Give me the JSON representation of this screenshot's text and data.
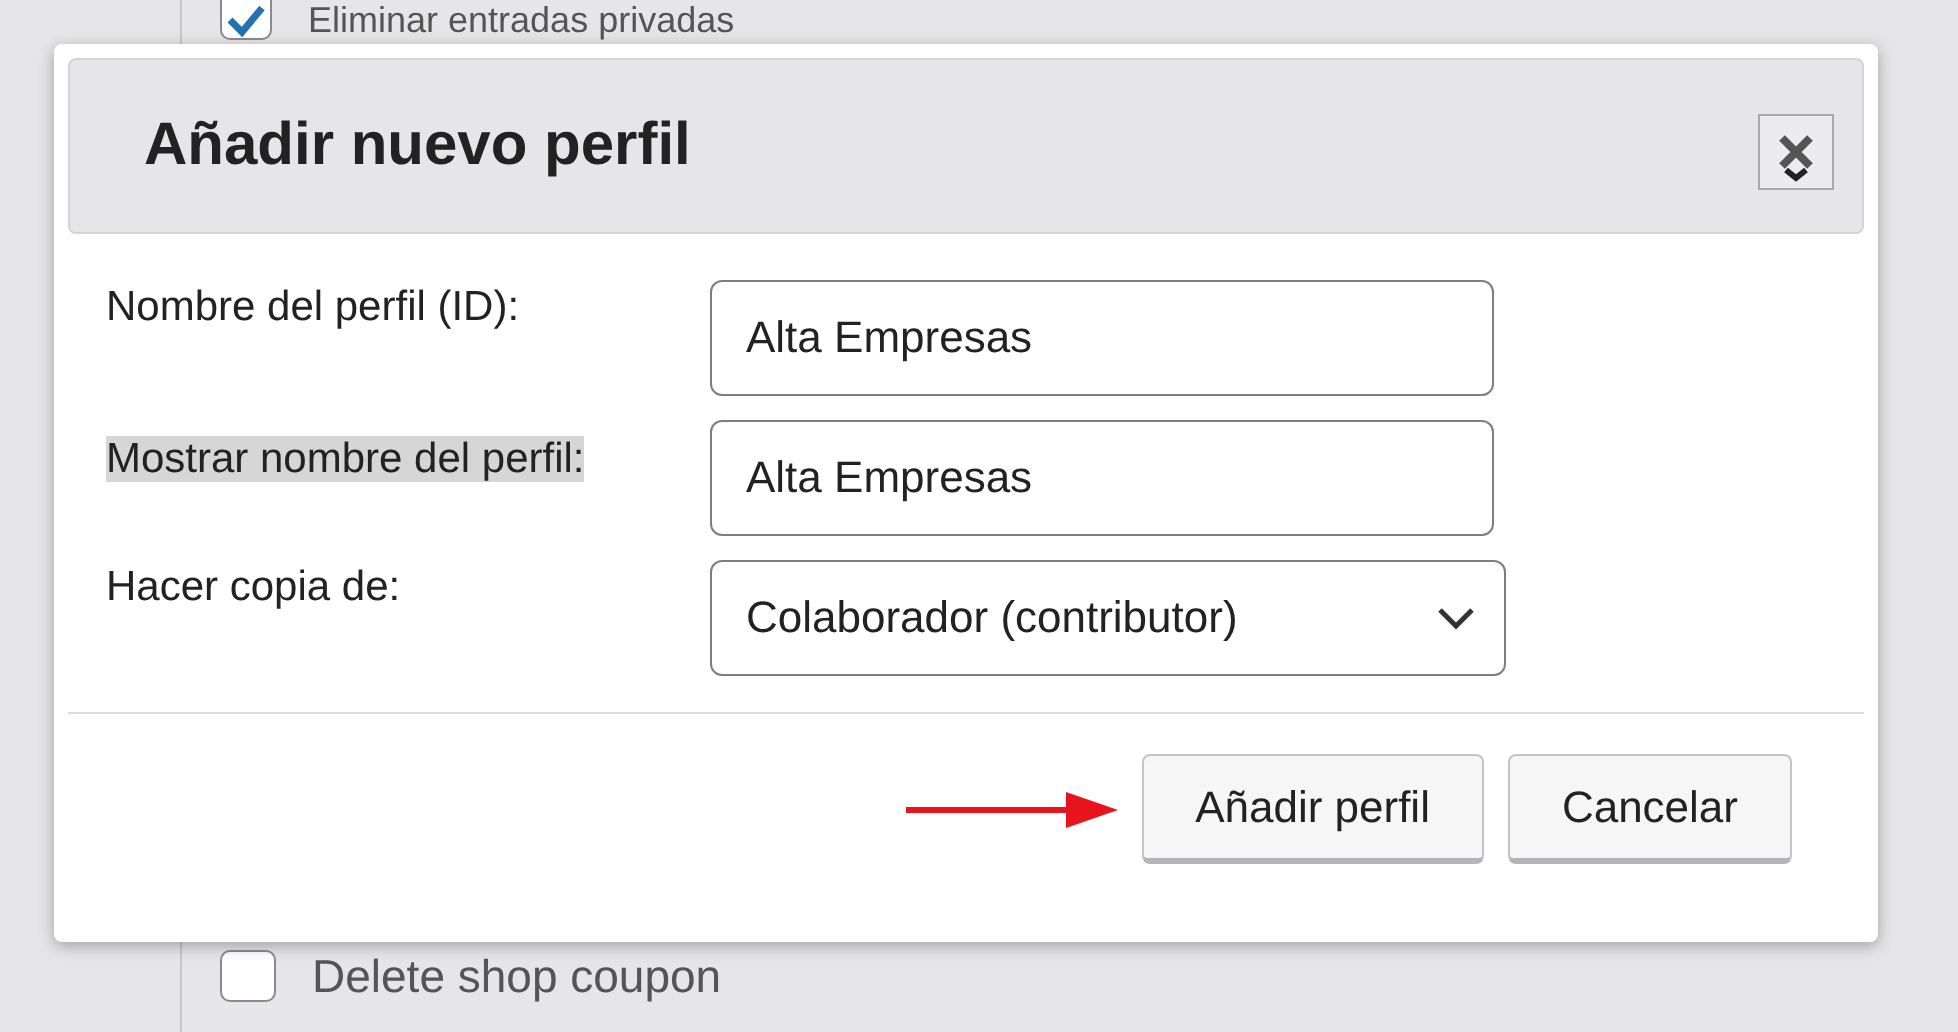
{
  "background_list": [
    {
      "label": "Eliminar entradas privadas",
      "checked": true
    },
    {
      "label": "Delete shop coupon",
      "checked": false
    }
  ],
  "dialog": {
    "title": "Añadir nuevo perfil",
    "fields": [
      {
        "kind": "text",
        "label": "Nombre del perfil (ID):",
        "value": "Alta Empresas",
        "highlighted": false
      },
      {
        "kind": "text",
        "label": "Mostrar nombre del perfil:",
        "value": "Alta Empresas",
        "highlighted": true
      },
      {
        "kind": "select",
        "label": "Hacer copia de:",
        "value": "Colaborador (contributor)",
        "highlighted": false
      }
    ],
    "buttons": [
      {
        "label": "Añadir perfil"
      },
      {
        "label": "Cancelar"
      }
    ]
  }
}
